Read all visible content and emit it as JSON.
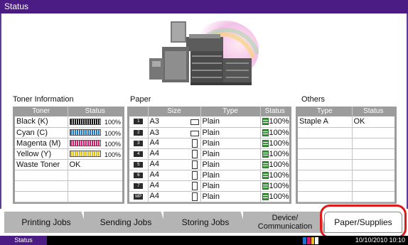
{
  "title": "Status",
  "sections": {
    "toner": "Toner Information",
    "paper": "Paper",
    "others": "Others"
  },
  "toner": {
    "headers": [
      "Toner",
      "Status"
    ],
    "rows": [
      {
        "name": "Black (K)",
        "level": "100%",
        "color": "#111111"
      },
      {
        "name": "Cyan (C)",
        "level": "100%",
        "color": "#1a74c9"
      },
      {
        "name": "Magenta (M)",
        "level": "100%",
        "color": "#d21b6c"
      },
      {
        "name": "Yellow (Y)",
        "level": "100%",
        "color": "#e2c21a"
      }
    ],
    "waste": {
      "name": "Waste Toner",
      "status": "OK"
    }
  },
  "paper": {
    "headers": [
      "",
      "Size",
      "Type",
      "Status"
    ],
    "rows": [
      {
        "tray": "1",
        "size": "A3",
        "orient": "landscape",
        "type": "Plain",
        "status": "100%"
      },
      {
        "tray": "2",
        "size": "A3",
        "orient": "landscape",
        "type": "Plain",
        "status": "100%"
      },
      {
        "tray": "3",
        "size": "A4",
        "orient": "portrait",
        "type": "Plain",
        "status": "100%"
      },
      {
        "tray": "4",
        "size": "A4",
        "orient": "portrait",
        "type": "Plain",
        "status": "100%"
      },
      {
        "tray": "5",
        "size": "A4",
        "orient": "portrait",
        "type": "Plain",
        "status": "100%"
      },
      {
        "tray": "6",
        "size": "A4",
        "orient": "portrait",
        "type": "Plain",
        "status": "100%"
      },
      {
        "tray": "7",
        "size": "A4",
        "orient": "portrait",
        "type": "Plain",
        "status": "100%"
      },
      {
        "tray": "MP",
        "size": "A4",
        "orient": "portrait",
        "type": "Plain",
        "status": "100%"
      }
    ]
  },
  "others": {
    "headers": [
      "Type",
      "Status"
    ],
    "rows": [
      {
        "type": "Staple A",
        "status": "OK"
      }
    ]
  },
  "tabs": [
    "Printing Jobs",
    "Sending Jobs",
    "Storing Jobs",
    "Device/\nCommunication",
    "Paper/Supplies"
  ],
  "active_tab": "Paper/Supplies",
  "statusbar": {
    "button": "Status",
    "datetime": "10/10/2010  10:10"
  }
}
